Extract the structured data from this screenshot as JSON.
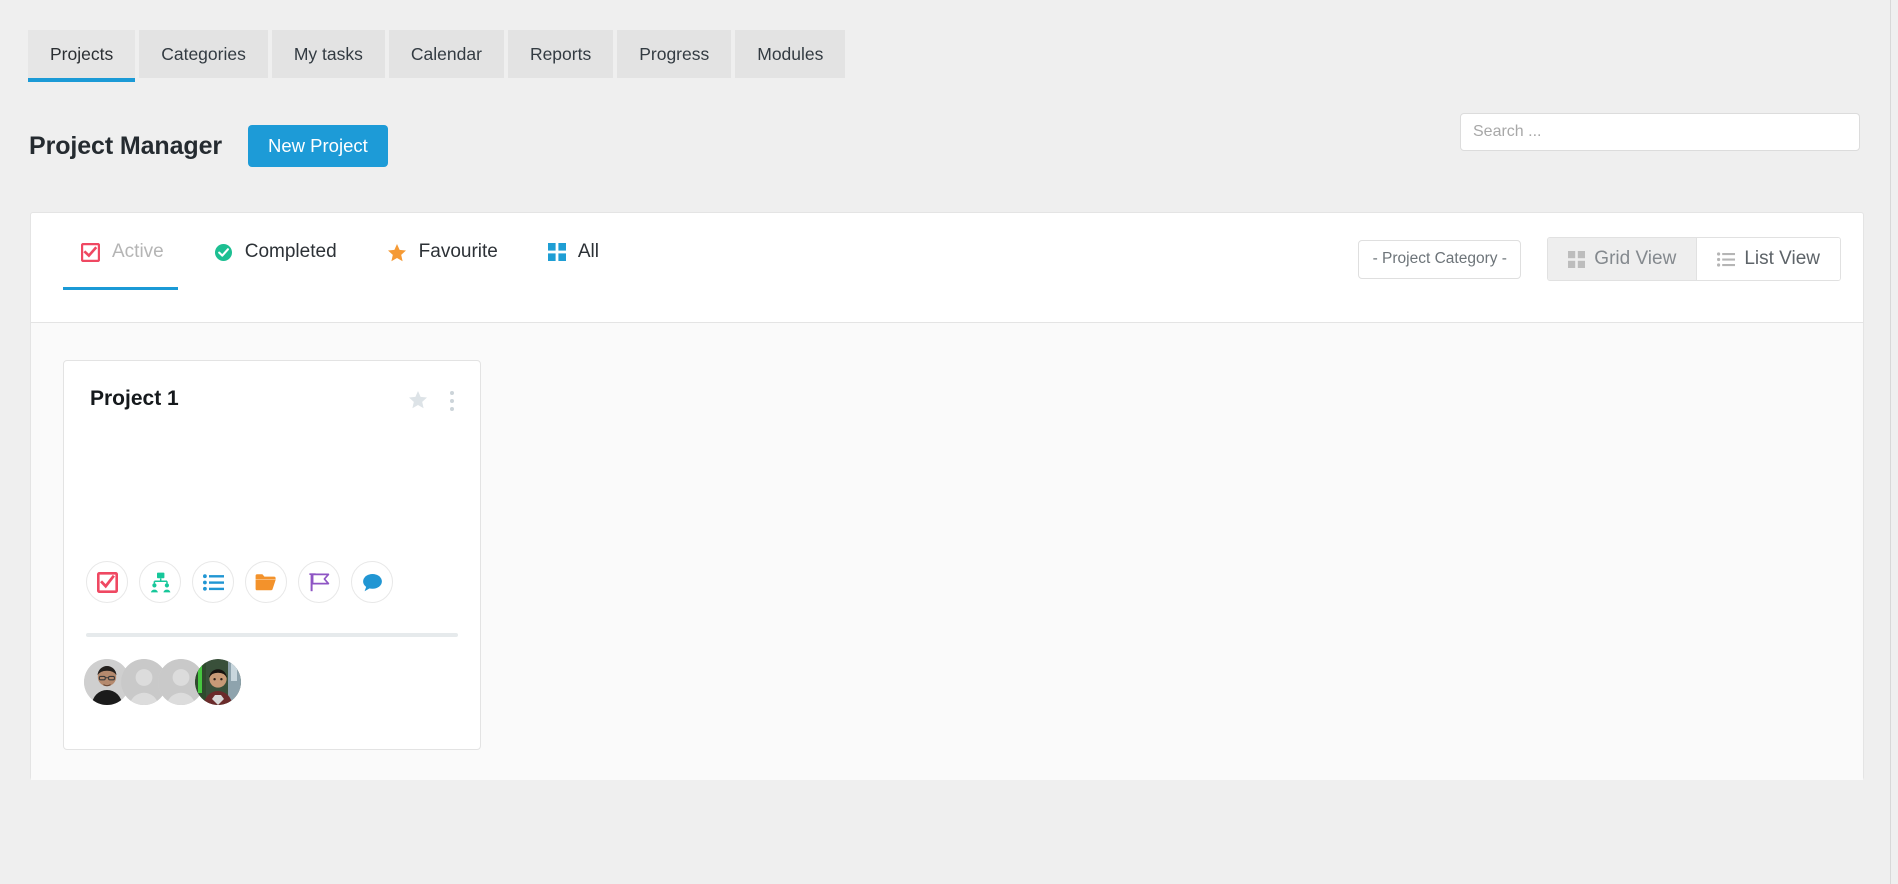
{
  "nav": {
    "tabs": [
      {
        "label": "Projects",
        "active": true
      },
      {
        "label": "Categories",
        "active": false
      },
      {
        "label": "My tasks",
        "active": false
      },
      {
        "label": "Calendar",
        "active": false
      },
      {
        "label": "Reports",
        "active": false
      },
      {
        "label": "Progress",
        "active": false
      },
      {
        "label": "Modules",
        "active": false
      }
    ]
  },
  "header": {
    "title": "Project Manager",
    "new_project_label": "New Project"
  },
  "search": {
    "value": "",
    "placeholder": "Search ..."
  },
  "panel": {
    "filters": [
      {
        "label": "Active",
        "icon": "checkbox-icon",
        "color": "#ef4862",
        "active": true
      },
      {
        "label": "Completed",
        "icon": "check-circle-icon",
        "color": "#1dbf92",
        "active": false
      },
      {
        "label": "Favourite",
        "icon": "star-icon",
        "color": "#f59a35",
        "active": false
      },
      {
        "label": "All",
        "icon": "grid-icon",
        "color": "#1f9ed4",
        "active": false
      }
    ],
    "category_select": {
      "selected": "- Project Category -"
    },
    "view_toggle": {
      "grid_label": "Grid View",
      "list_label": "List View",
      "active": "grid"
    }
  },
  "projects": [
    {
      "title": "Project 1",
      "favourite": false,
      "actions": [
        {
          "name": "tasks-icon",
          "color": "#ef4862"
        },
        {
          "name": "users-icon",
          "color": "#16c79a"
        },
        {
          "name": "list-icon",
          "color": "#2196d3"
        },
        {
          "name": "folder-icon",
          "color": "#f3922b"
        },
        {
          "name": "milestone-icon",
          "color": "#8e55c4"
        },
        {
          "name": "comment-icon",
          "color": "#2196d3"
        }
      ],
      "members": [
        {
          "type": "photo-dark"
        },
        {
          "type": "placeholder"
        },
        {
          "type": "placeholder"
        },
        {
          "type": "photo-green"
        }
      ]
    }
  ],
  "colors": {
    "accent": "#1d9bd7",
    "page_bg": "#efefef",
    "panel_bg": "#ffffff",
    "body_bg": "#fafafa"
  }
}
